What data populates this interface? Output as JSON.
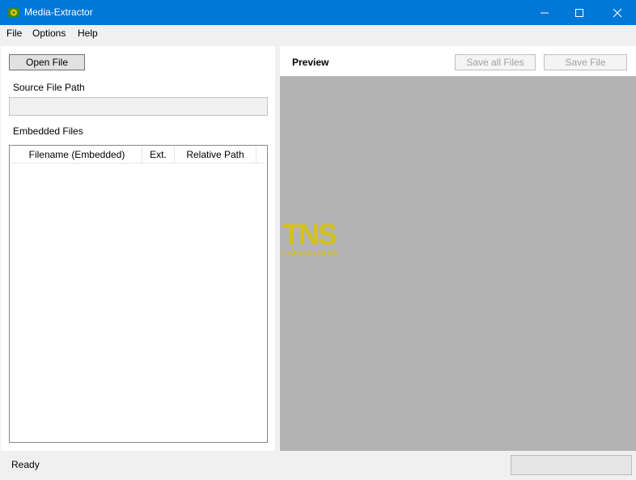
{
  "window": {
    "title": "Media-Extractor",
    "accent_color": "#0078d7",
    "app_icon": "media-extractor-app-icon",
    "controls": {
      "minimize_icon": "minimize-icon",
      "maximize_icon": "maximize-icon",
      "close_icon": "close-icon"
    }
  },
  "menu": [
    "File",
    "Options",
    "Help"
  ],
  "left": {
    "open_button": "Open File",
    "source_label": "Source File Path",
    "source_value": "",
    "embedded_label": "Embedded Files",
    "columns": [
      "Filename (Embedded)",
      "Ext.",
      "Relative Path"
    ],
    "rows": []
  },
  "right": {
    "title": "Preview",
    "save_all_button": "Save all Files",
    "save_file_button": "Save File",
    "preview_bg": "#b3b3b3",
    "watermark": {
      "logo_text": "TNS",
      "caption": "TRẢI NGHIỆM SỐ",
      "color": "#d4c21c"
    }
  },
  "status": {
    "text": "Ready",
    "progress": 0
  }
}
